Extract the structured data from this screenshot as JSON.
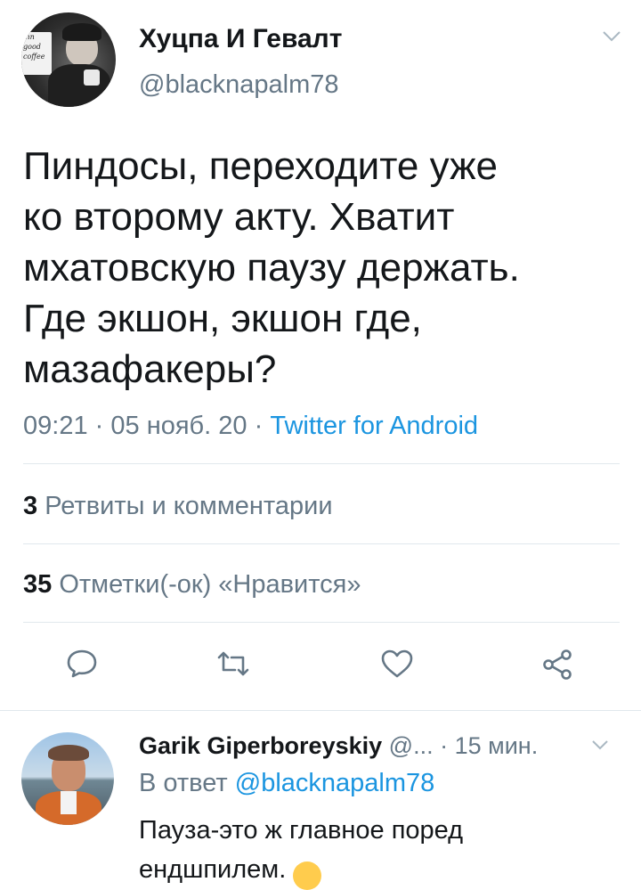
{
  "tweet": {
    "author_name": "Хуцпа И Гевалт",
    "author_handle": "@blacknapalm78",
    "avatar_text": "mn\ngood\ncoffee",
    "lines": [
      "Пиндосы, переходите уже",
      "ко второму акту. Хватит",
      "мхатовскую паузу держать.",
      "Где экшон, экшон где,",
      "мазафакеры?"
    ],
    "time": "09:21",
    "sep1": "·",
    "date": "05 нояб. 20",
    "sep2": "·",
    "source": "Twitter for Android",
    "retweets_count": "3",
    "retweets_label": "Ретвиты и комментарии",
    "likes_count": "35",
    "likes_label": "Отметки(-ок) «Нравится»"
  },
  "actions": {
    "reply_icon": "speech-bubble-icon",
    "retweet_icon": "retweet-arrows-icon",
    "like_icon": "heart-icon",
    "share_icon": "share-nodes-icon"
  },
  "reply": {
    "author_name": "Garik Giperboreyskiy",
    "handle_truncated": "@...",
    "sep": "·",
    "time_ago": "15 мин.",
    "in_reply_prefix": "В ответ",
    "in_reply_handle": "@blacknapalm78",
    "text_line1": "Пауза-это ж главное поред",
    "text_line2": "ендшпилем.",
    "emoji": "😁"
  },
  "colors": {
    "text": "#14171a",
    "muted": "#657786",
    "link": "#1b95e0",
    "divider": "#e1e8ed"
  }
}
